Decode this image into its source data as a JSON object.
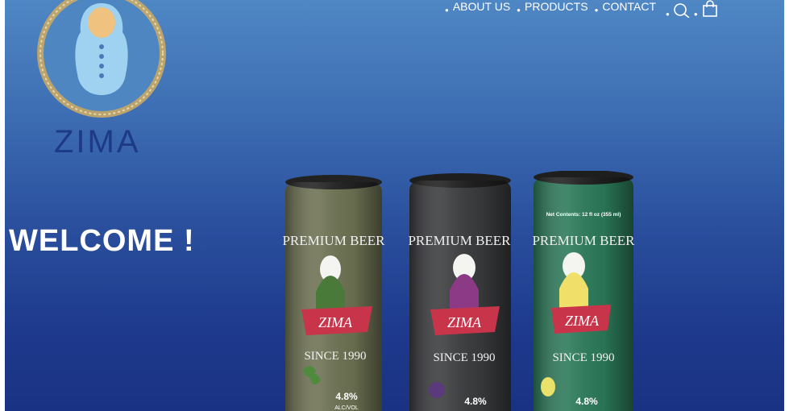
{
  "brand": {
    "name": "ZIMA"
  },
  "nav": {
    "items": [
      {
        "label": "ABOUT US"
      },
      {
        "label": "PRODUCTS"
      },
      {
        "label": "CONTACT"
      }
    ],
    "search_icon": "search-icon",
    "cart_icon": "shopping-bag-icon"
  },
  "hero": {
    "welcome": "WELCOME !"
  },
  "products": [
    {
      "arc_text": "PREMIUM BEER",
      "brand": "ZIMA",
      "since": "SINCE 1990",
      "abv": "4.8%",
      "abv_label": "ALC/VOL",
      "color": "#6e7253",
      "fruit": "herb"
    },
    {
      "arc_text": "PREMIUM BEER",
      "brand": "ZIMA",
      "since": "SINCE 1990",
      "abv": "4.8%",
      "color": "#3a3b3d",
      "fruit": "blackberry"
    },
    {
      "net_contents": "Net Contents: 12 fl oz (355 ml)",
      "arc_text": "PREMIUM BEER",
      "brand": "ZIMA",
      "since": "SINCE 1990",
      "abv": "4.8%",
      "color": "#2c7a5a",
      "fruit": "lemon"
    }
  ],
  "colors": {
    "background_top": "#4f87c4",
    "background_bottom": "#1a3283",
    "brand_blue": "#1c3a86",
    "ribbon_red": "#c8354a"
  }
}
